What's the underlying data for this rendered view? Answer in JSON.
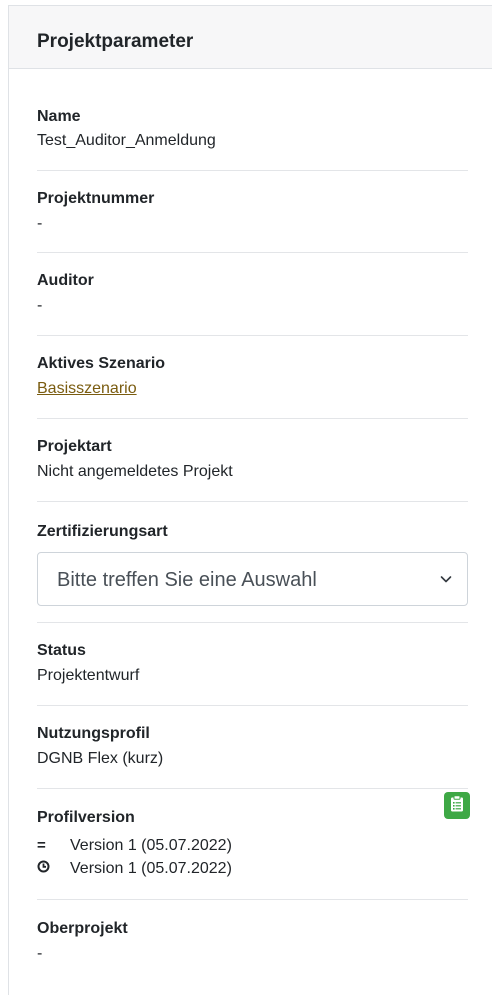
{
  "header": {
    "title": "Projektparameter"
  },
  "params": {
    "name": {
      "label": "Name",
      "value": "Test_Auditor_Anmeldung"
    },
    "projektnummer": {
      "label": "Projektnummer",
      "value": "-"
    },
    "auditor": {
      "label": "Auditor",
      "value": "-"
    },
    "aktives_szenario": {
      "label": "Aktives Szenario",
      "value": "Basisszenario"
    },
    "projektart": {
      "label": "Projektart",
      "value": "Nicht angemeldetes Projekt"
    },
    "zertifizierungsart": {
      "label": "Zertifizierungsart",
      "selected": "Bitte treffen Sie eine Auswahl"
    },
    "status": {
      "label": "Status",
      "value": "Projektentwurf"
    },
    "nutzungsprofil": {
      "label": "Nutzungsprofil",
      "value": "DGNB Flex (kurz)"
    },
    "profilversion": {
      "label": "Profilversion",
      "versions": [
        {
          "icon": "equals-icon",
          "symbol": "=",
          "text": "Version 1 (05.07.2022)"
        },
        {
          "icon": "clock-icon",
          "symbol": "◷",
          "text": "Version 1 (05.07.2022)"
        }
      ],
      "button_icon": "clipboard-list-icon",
      "button_color": "#3ea845"
    },
    "oberprojekt": {
      "label": "Oberprojekt",
      "value": "-"
    }
  },
  "colors": {
    "link": "#7a5c10",
    "header_bg": "#f7f7f8",
    "accent_green": "#3ea845"
  }
}
